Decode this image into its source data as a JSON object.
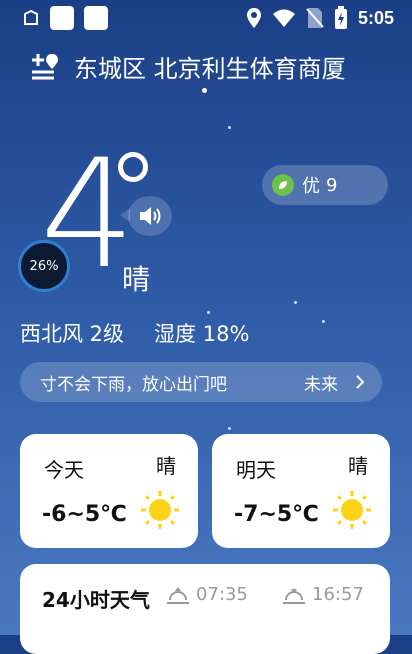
{
  "status_bar": {
    "time": "5:05"
  },
  "header": {
    "location": "东城区 北京利生体育商厦"
  },
  "current": {
    "temperature": "4",
    "condition": "晴",
    "badge_percent": "26%",
    "wind": "西北风 2级",
    "humidity": "湿度 18%"
  },
  "aqi": {
    "label": "优",
    "value": "9",
    "leaf_color": "#6cc24a"
  },
  "tip": {
    "text": "寸不会下雨，放心出门吧",
    "more": "未来"
  },
  "forecast": [
    {
      "day": "今天",
      "condition": "晴",
      "range": "-6~5℃"
    },
    {
      "day": "明天",
      "condition": "晴",
      "range": "-7~5℃"
    }
  ],
  "hourly": {
    "title": "24小时天气",
    "sunrise": "07:35",
    "sunset": "16:57"
  },
  "colors": {
    "bg_top": "#1b3f86",
    "bg_bottom": "#4a78c0",
    "sun": "#ffd21a"
  }
}
